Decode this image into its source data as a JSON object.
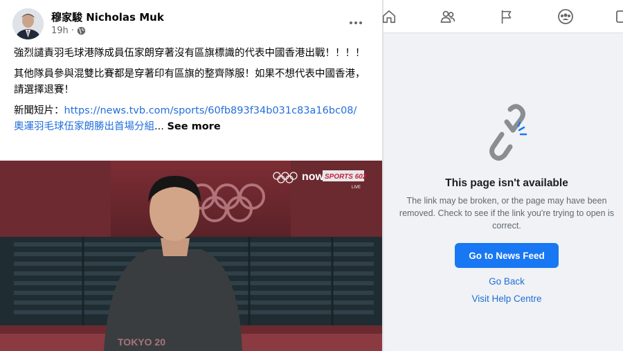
{
  "post": {
    "author": "穆家駿 Nicholas Muk",
    "time": "19h",
    "paragraph1": "強烈譴責羽毛球港隊成員伍家朗穿著沒有區旗標識的代表中國香港出戰！！！！",
    "paragraph2": "其他隊員參與混雙比賽都是穿著印有區旗的整齊隊服！如果不想代表中國香港，請選擇退賽！",
    "news_label": "新聞短片：",
    "news_link": "https://news.tvb.com/sports/60fb893f34b031c83a16bc08/",
    "news_link_title": "奧運羽毛球伍家朗勝出首場分組",
    "see_more": "See more",
    "video": {
      "broadcaster": "now",
      "channel": "SPORTS 602",
      "live": "LIVE",
      "venue_text": "TOKYO 20"
    }
  },
  "unavailable": {
    "title": "This page isn't available",
    "description": "The link may be broken, or the page may have been removed. Check to see if the link you're trying to open is correct.",
    "primary_button": "Go to News Feed",
    "back_link": "Go Back",
    "help_link": "Visit Help Centre"
  },
  "nav": {
    "icons": [
      "home-icon",
      "friends-icon",
      "pages-flag-icon",
      "groups-icon",
      "video-icon"
    ]
  },
  "colors": {
    "facebook_blue": "#1877f2",
    "link_blue": "#216fdb",
    "panel_bg": "#f0f2f5"
  }
}
